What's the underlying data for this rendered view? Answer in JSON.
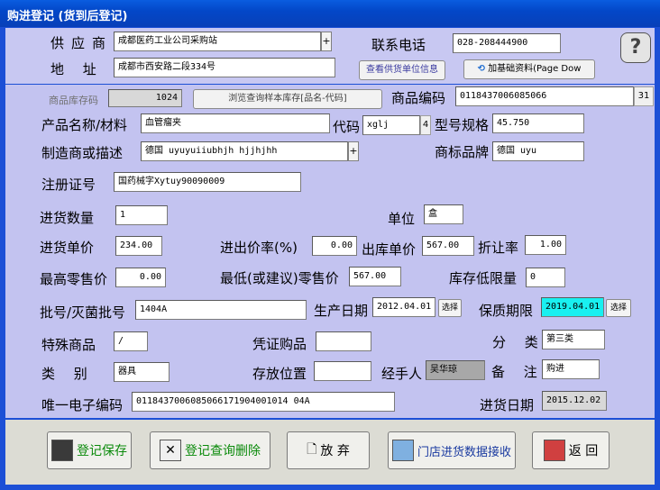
{
  "window": {
    "title": "购进登记 (货到后登记)"
  },
  "supplier": {
    "label": "供应商",
    "value": "成都医药工业公司采购站",
    "address_label": "地 址",
    "address_value": "成都市西安路二段334号",
    "phone_label": "联系电话",
    "phone_value": "028-208444900",
    "view_supplier_button": "查看供货单位信息",
    "add_base_button": "加基础资料(Page Dow",
    "help_icon": "help-icon"
  },
  "product": {
    "stock_code_label": "商品库存码",
    "stock_code_value": "1024",
    "browse_button": "浏览查询样本库存[品名-代码]",
    "code_label": "商品编码",
    "code_value": "0118437006085066",
    "code_count": "31",
    "name_label": "产品名称/材料",
    "name_value": "血管瘤夹",
    "short_code_label": "代码",
    "short_code_value": "xglj",
    "short_code_len": "4",
    "spec_label": "型号规格",
    "spec_value": "45.750",
    "maker_label": "制造商或描述",
    "maker_value": "德国 uyuyuiiubhjh hjjhjhh",
    "brand_label": "商标品牌",
    "brand_value": "德国 uyu",
    "reg_label": "注册证号",
    "reg_value": "国药械字Xytuy90090009"
  },
  "purchase": {
    "qty_label": "进货数量",
    "qty_value": "1",
    "unit_label": "单位",
    "unit_value": "盒",
    "price_label": "进货单价",
    "price_value": "234.00",
    "ratio_label": "进出价率(%)",
    "ratio_value": "0.00",
    "out_price_label": "出库单价",
    "out_price_value": "567.00",
    "discount_label": "折让率",
    "discount_value": "1.00",
    "max_retail_label": "最高零售价",
    "max_retail_value": "0.00",
    "min_retail_label": "最低(或建议)零售价",
    "min_retail_value": "567.00",
    "stock_min_label": "库存低限量",
    "stock_min_value": "0",
    "batch_label": "批号/灭菌批号",
    "batch_value": "1404A",
    "mfg_date_label": "生产日期",
    "mfg_date_value": "2012.04.01",
    "select_label": "选择",
    "expiry_label": "保质期限",
    "expiry_value": "2019.04.01",
    "special_label": "特殊商品",
    "special_value": "/",
    "voucher_label": "凭证购品",
    "voucher_value": "",
    "class_label": "分 类",
    "class_value": "第三类",
    "category_label": "类 别",
    "category_value": "器具",
    "location_label": "存放位置",
    "location_value": "",
    "handler_label": "经手人",
    "handler_value": "吴华琼",
    "note_label": "备 注",
    "note_value": "购进",
    "ecode_label": "唯一电子编码",
    "ecode_value": "0118437006085066171904001014 04A",
    "in_date_label": "进货日期",
    "in_date_value": "2015.12.02"
  },
  "actions": {
    "save": "登记保存",
    "query_delete": "登记查询删除",
    "discard": "放 弃",
    "receive": "门店进货数据接收",
    "back": "返 回"
  }
}
